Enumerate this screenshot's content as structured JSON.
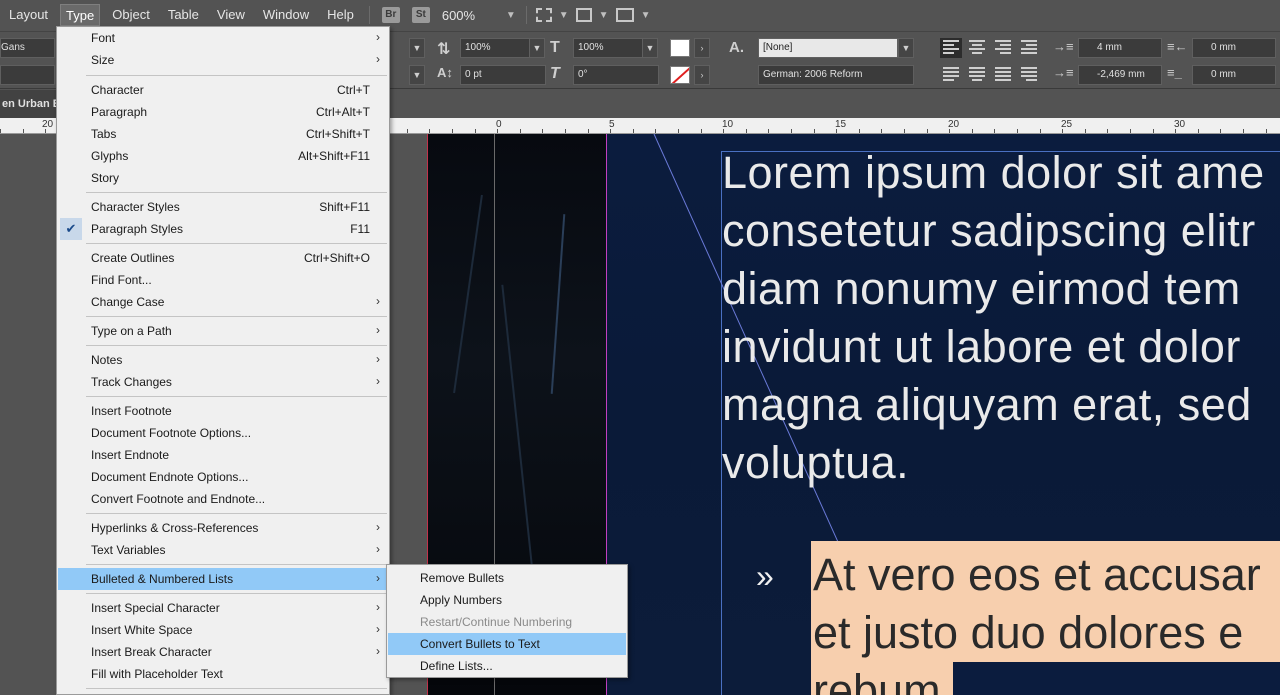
{
  "menubar": {
    "items": [
      "Layout",
      "Type",
      "Object",
      "Table",
      "View",
      "Window",
      "Help"
    ],
    "active": "Type",
    "badges": [
      "Br",
      "St"
    ],
    "zoom": "600%"
  },
  "control_panel": {
    "font_family_partial": "Gans",
    "vscale": "100%",
    "hscale": "100%",
    "baseline_shift": "0 pt",
    "skew": "0°",
    "char_style": "[None]",
    "language": "German: 2006 Reform",
    "left_indent": "4 mm",
    "first_line_indent": "-2,469 mm",
    "right_indent": "0 mm",
    "space_after": "0 mm"
  },
  "document_tab": "en Urban E",
  "ruler": {
    "labels": [
      "20",
      "0",
      "5",
      "10",
      "15",
      "20",
      "25",
      "30"
    ]
  },
  "canvas": {
    "body_lines": [
      "Lorem ipsum dolor sit ame",
      "consetetur sadipscing elitr",
      "diam nonumy eirmod tem",
      "invidunt ut labore et dolor",
      "magna aliquyam erat, sed",
      "voluptua."
    ],
    "bullet_char": "»",
    "bullet_lines": [
      "At vero eos et accusar",
      "et justo duo dolores e",
      "rebum."
    ]
  },
  "type_menu": {
    "items": [
      {
        "label": "Font",
        "shortcut": "",
        "submenu": true
      },
      {
        "label": "Size",
        "shortcut": "",
        "submenu": true
      },
      {
        "label": "Character",
        "shortcut": "Ctrl+T",
        "submenu": false
      },
      {
        "label": "Paragraph",
        "shortcut": "Ctrl+Alt+T",
        "submenu": false
      },
      {
        "label": "Tabs",
        "shortcut": "Ctrl+Shift+T",
        "submenu": false
      },
      {
        "label": "Glyphs",
        "shortcut": "Alt+Shift+F11",
        "submenu": false
      },
      {
        "label": "Story",
        "shortcut": "",
        "submenu": false
      },
      {
        "label": "Character Styles",
        "shortcut": "Shift+F11",
        "submenu": false
      },
      {
        "label": "Paragraph Styles",
        "shortcut": "F11",
        "submenu": false,
        "checked": true
      },
      {
        "label": "Create Outlines",
        "shortcut": "Ctrl+Shift+O",
        "submenu": false
      },
      {
        "label": "Find Font...",
        "shortcut": "",
        "submenu": false
      },
      {
        "label": "Change Case",
        "shortcut": "",
        "submenu": true
      },
      {
        "label": "Type on a Path",
        "shortcut": "",
        "submenu": true
      },
      {
        "label": "Notes",
        "shortcut": "",
        "submenu": true
      },
      {
        "label": "Track Changes",
        "shortcut": "",
        "submenu": true
      },
      {
        "label": "Insert Footnote",
        "shortcut": "",
        "submenu": false
      },
      {
        "label": "Document Footnote Options...",
        "shortcut": "",
        "submenu": false
      },
      {
        "label": "Insert Endnote",
        "shortcut": "",
        "submenu": false
      },
      {
        "label": "Document Endnote Options...",
        "shortcut": "",
        "submenu": false
      },
      {
        "label": "Convert Footnote and Endnote...",
        "shortcut": "",
        "submenu": false
      },
      {
        "label": "Hyperlinks & Cross-References",
        "shortcut": "",
        "submenu": true
      },
      {
        "label": "Text Variables",
        "shortcut": "",
        "submenu": true
      },
      {
        "label": "Bulleted & Numbered Lists",
        "shortcut": "",
        "submenu": true,
        "highlighted": true
      },
      {
        "label": "Insert Special Character",
        "shortcut": "",
        "submenu": true
      },
      {
        "label": "Insert White Space",
        "shortcut": "",
        "submenu": true
      },
      {
        "label": "Insert Break Character",
        "shortcut": "",
        "submenu": true
      },
      {
        "label": "Fill with Placeholder Text",
        "shortcut": "",
        "submenu": false
      }
    ]
  },
  "lists_submenu": {
    "items": [
      {
        "label": "Remove Bullets",
        "disabled": false
      },
      {
        "label": "Apply Numbers",
        "disabled": false
      },
      {
        "label": "Restart/Continue Numbering",
        "disabled": true
      },
      {
        "label": "Convert Bullets to Text",
        "disabled": false,
        "highlighted": true
      },
      {
        "label": "Define Lists...",
        "disabled": false
      }
    ]
  },
  "colors": {
    "menu_highlight": "#91c9f7",
    "ui_background": "#535353",
    "bullet_box": "#f7cfae"
  }
}
